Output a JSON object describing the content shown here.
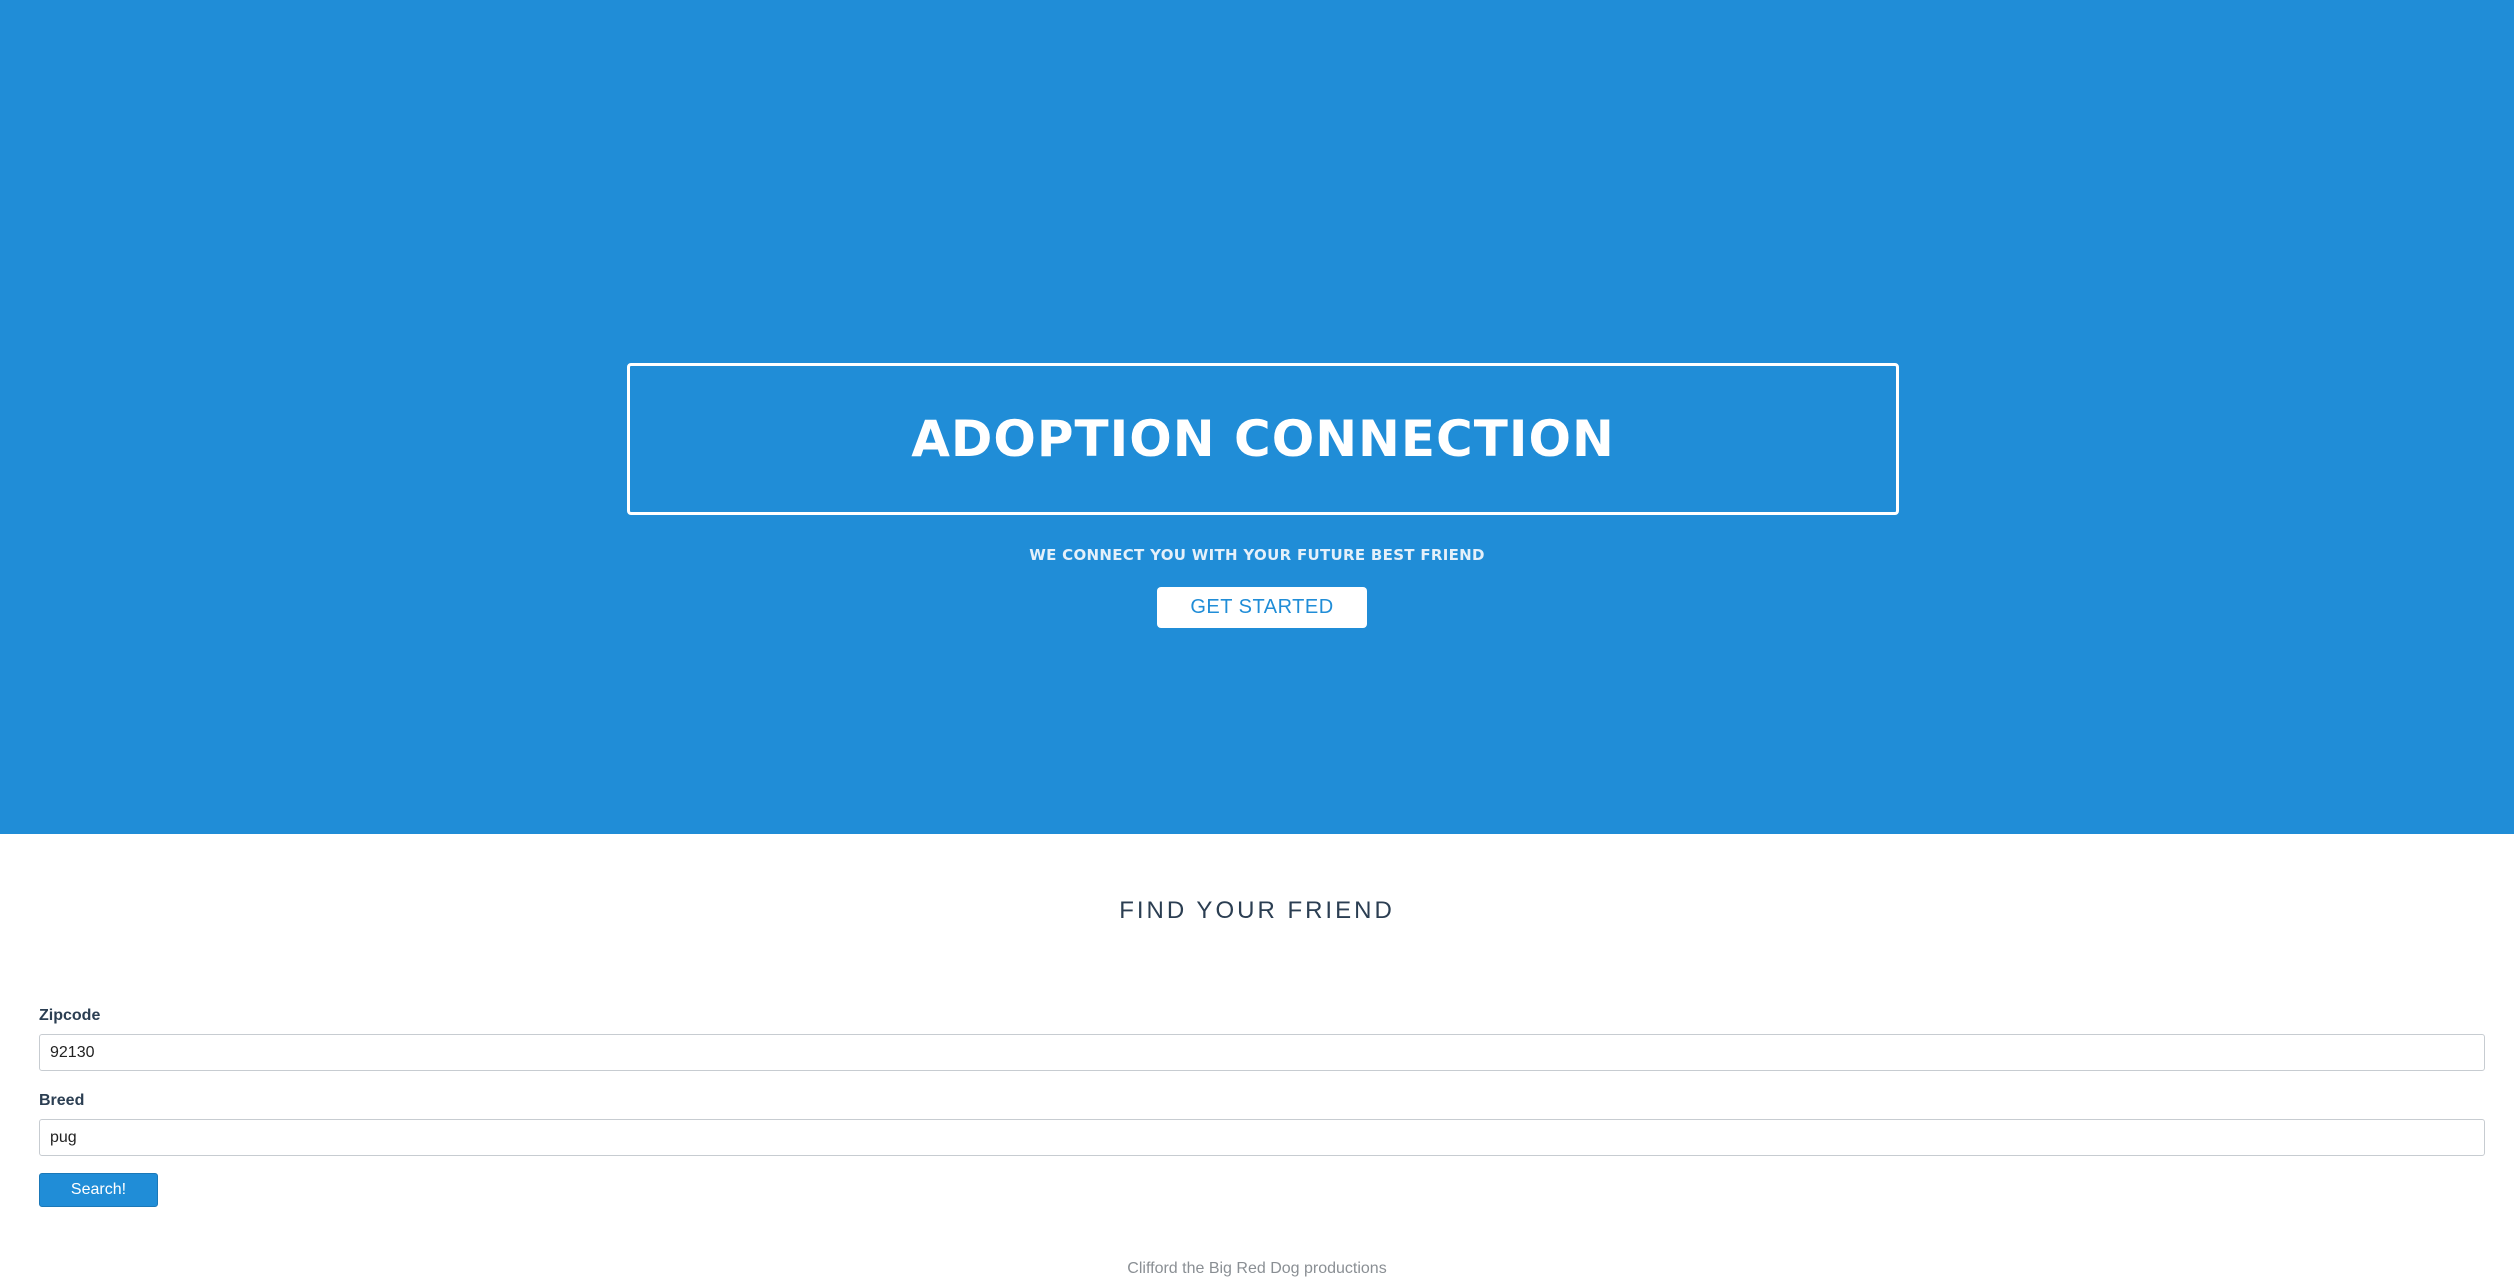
{
  "hero": {
    "title": "ADOPTION CONNECTION",
    "tagline": "WE CONNECT YOU WITH YOUR FUTURE BEST FRIEND",
    "cta_label": "GET STARTED"
  },
  "search": {
    "heading": "FIND YOUR FRIEND",
    "zipcode_label": "Zipcode",
    "zipcode_value": "92130",
    "breed_label": "Breed",
    "breed_value": "pug",
    "submit_label": "Search!"
  },
  "footer": {
    "text": "Clifford the Big Red Dog productions"
  },
  "colors": {
    "brand_blue": "#208dd7",
    "heading_text": "#2b3e52",
    "footer_text": "#8a8f94"
  }
}
